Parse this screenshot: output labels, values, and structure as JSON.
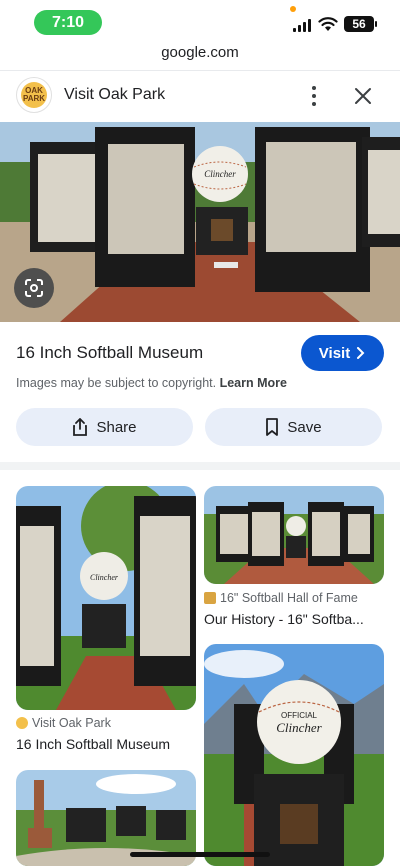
{
  "status_bar": {
    "time": "7:10",
    "battery": "56"
  },
  "browser": {
    "url": "google.com"
  },
  "header": {
    "site_title": "Visit Oak Park",
    "logo_text": "OAK PARK"
  },
  "result": {
    "title": "16 Inch Softball Museum",
    "visit_label": "Visit",
    "copyright_text": "Images may be subject to copyright.",
    "learn_more": "Learn More",
    "share_label": "Share",
    "save_label": "Save",
    "hero_ball_text": "OFFICIAL Clincher"
  },
  "grid": [
    {
      "source": "Visit Oak Park",
      "title": "16 Inch Softball Museum"
    },
    {
      "source": "16\" Softball Hall of Fame",
      "title": "Our History - 16\" Softba..."
    },
    {
      "source": "",
      "title": ""
    },
    {
      "source": "",
      "title": ""
    }
  ],
  "colors": {
    "accent": "#0b57d0",
    "pill_bg": "#e8eef9",
    "time_pill": "#34c759"
  }
}
